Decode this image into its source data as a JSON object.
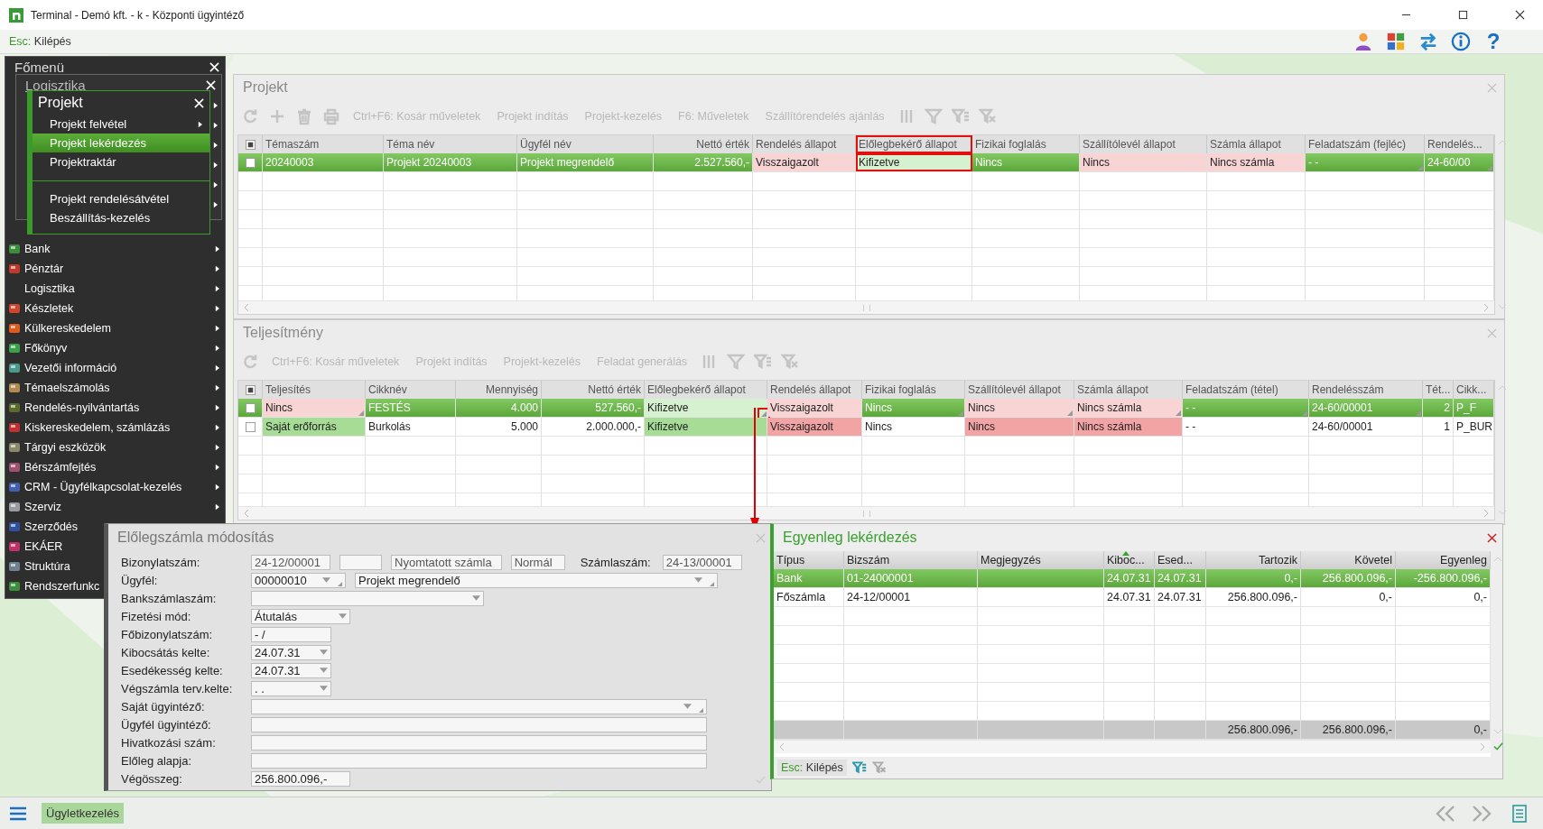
{
  "window": {
    "title": "Terminal - Demó kft. - k - Központi ügyintéző"
  },
  "top_bar": {
    "exit": {
      "key": "Esc:",
      "label": "Kilépés"
    },
    "help_glyph": "?"
  },
  "main_menu": {
    "title": "Főmenü",
    "items": [
      {
        "label": "Bank",
        "icon": true,
        "submenu": true
      },
      {
        "label": "Pénztár",
        "icon": true,
        "submenu": true
      },
      {
        "label": "Logisztika",
        "icon": false,
        "submenu": true
      },
      {
        "label": "Készletek",
        "icon": true,
        "submenu": true
      },
      {
        "label": "Külkereskedelem",
        "icon": true,
        "submenu": true
      },
      {
        "label": "Főkönyv",
        "icon": true,
        "submenu": true
      },
      {
        "label": "Vezetői információ",
        "icon": true,
        "submenu": true
      },
      {
        "label": "Témaelszámolás",
        "icon": true,
        "submenu": true
      },
      {
        "label": "Rendelés-nyilvántartás",
        "icon": true,
        "submenu": true
      },
      {
        "label": "Kiskereskedelem, számlázás",
        "icon": true,
        "submenu": true
      },
      {
        "label": "Tárgyi eszközök",
        "icon": true,
        "submenu": true
      },
      {
        "label": "Bérszámfejtés",
        "icon": true,
        "submenu": true
      },
      {
        "label": "CRM - Ügyfélkapcsolat-kezelés",
        "icon": true,
        "submenu": true
      },
      {
        "label": "Szerviz",
        "icon": true,
        "submenu": true
      },
      {
        "label": "Szerződés",
        "icon": true,
        "submenu": false
      },
      {
        "label": "EKÁER",
        "icon": true,
        "submenu": false
      },
      {
        "label": "Struktúra",
        "icon": true,
        "submenu": false
      },
      {
        "label": "Rendszerfunkc",
        "icon": true,
        "submenu": false
      }
    ]
  },
  "logistics_menu": {
    "title": "Logisztika"
  },
  "project_menu": {
    "title": "Projekt",
    "items": [
      {
        "kind": "item",
        "label": "Projekt felvétel",
        "selected": false,
        "submenu": true
      },
      {
        "kind": "item",
        "label": "Projekt lekérdezés",
        "selected": true,
        "submenu": false
      },
      {
        "kind": "item",
        "label": "Projektraktár",
        "selected": false,
        "submenu": false
      },
      {
        "kind": "separator"
      },
      {
        "kind": "item",
        "label": "Projekt rendelésátvétel",
        "selected": false,
        "submenu": false
      },
      {
        "kind": "item",
        "label": "Beszállítás-kezelés",
        "selected": false,
        "submenu": false
      }
    ]
  },
  "panels": [
    {
      "title": "Projekt",
      "select_all_partial": true,
      "toolbar": [
        {
          "kind": "refresh",
          "disabled": true
        },
        {
          "kind": "add",
          "disabled": true
        },
        {
          "kind": "delete",
          "disabled": true
        },
        {
          "kind": "print",
          "disabled": true
        },
        {
          "kind": "text",
          "label": "Ctrl+F6: Kosár műveletek",
          "disabled": true
        },
        {
          "kind": "text",
          "label": "Projekt indítás",
          "disabled": true
        },
        {
          "kind": "text",
          "label": "Projekt-kezelés",
          "disabled": true
        },
        {
          "kind": "text",
          "label": "F6: Műveletek",
          "disabled": true
        },
        {
          "kind": "text",
          "label": "Szállítórendelés ajánlás",
          "disabled": true
        },
        {
          "kind": "columns",
          "disabled": true
        },
        {
          "kind": "filter",
          "disabled": true
        },
        {
          "kind": "filter-add",
          "disabled": true
        },
        {
          "kind": "filter-clear",
          "disabled": true
        }
      ],
      "columns": [
        {
          "label": "Témaszám",
          "highlighted": false
        },
        {
          "label": "Téma név",
          "highlighted": false
        },
        {
          "label": "Ügyfél név",
          "highlighted": false
        },
        {
          "label": "Nettó érték",
          "highlighted": false
        },
        {
          "label": "Rendelés állapot",
          "highlighted": false
        },
        {
          "label": "Előlegbekérő állapot",
          "highlighted": true
        },
        {
          "label": "Fizikai foglalás",
          "highlighted": false
        },
        {
          "label": "Szállítólevél állapot",
          "highlighted": false
        },
        {
          "label": "Számla állapot",
          "highlighted": false
        },
        {
          "label": "Feladatszám (fejléc)",
          "highlighted": false
        },
        {
          "label": "Rendelés...",
          "highlighted": false
        }
      ],
      "rows": [
        {
          "selected": true,
          "checked": false,
          "cells": [
            {
              "text": "20240003"
            },
            {
              "text": "Projekt 20240003"
            },
            {
              "text": "Projekt megrendelő"
            },
            {
              "text": "2.527.560,-"
            },
            {
              "text": "Visszaigazolt",
              "alert": true
            },
            {
              "text": "Kifizetve",
              "ok": true,
              "highlighted": true
            },
            {
              "text": "Nincs"
            },
            {
              "text": "Nincs",
              "alert": true
            },
            {
              "text": "Nincs számla",
              "alert": true
            },
            {
              "text": "- -",
              "corner": true
            },
            {
              "text": "24-60/00",
              "corner": true
            }
          ]
        }
      ]
    },
    {
      "title": "Teljesítmény",
      "select_all_partial": true,
      "toolbar": [
        {
          "kind": "refresh",
          "disabled": true
        },
        {
          "kind": "text",
          "label": "Ctrl+F6: Kosár műveletek",
          "disabled": true
        },
        {
          "kind": "text",
          "label": "Projekt indítás",
          "disabled": true
        },
        {
          "kind": "text",
          "label": "Projekt-kezelés",
          "disabled": true
        },
        {
          "kind": "text",
          "label": "Feladat generálás",
          "disabled": true
        },
        {
          "kind": "columns",
          "disabled": true
        },
        {
          "kind": "filter",
          "disabled": true
        },
        {
          "kind": "filter-add",
          "disabled": true
        },
        {
          "kind": "filter-clear",
          "disabled": true
        }
      ],
      "columns": [
        {
          "label": "Teljesítés",
          "highlighted": false
        },
        {
          "label": "Cikknév",
          "highlighted": false
        },
        {
          "label": "Mennyiség",
          "highlighted": false
        },
        {
          "label": "Nettó érték",
          "highlighted": false
        },
        {
          "label": "Előlegbekérő állapot",
          "highlighted": false
        },
        {
          "label": "Rendelés állapot",
          "highlighted": false
        },
        {
          "label": "Fizikai foglalás",
          "highlighted": false
        },
        {
          "label": "Szállítólevél állapot",
          "highlighted": false
        },
        {
          "label": "Számla állapot",
          "highlighted": false
        },
        {
          "label": "Feladatszám (tétel)",
          "highlighted": false
        },
        {
          "label": "Rendelésszám",
          "highlighted": false
        },
        {
          "label": "Tét...",
          "highlighted": false
        },
        {
          "label": "Cikk...",
          "highlighted": false
        }
      ],
      "rows": [
        {
          "selected": true,
          "checked": false,
          "cells": [
            {
              "text": "Nincs",
              "alert": true,
              "corner": true
            },
            {
              "text": "FESTÉS"
            },
            {
              "text": "4.000"
            },
            {
              "text": "527.560,-"
            },
            {
              "text": "Kifizetve",
              "ok": true,
              "corner": true,
              "corner_highlighted": true
            },
            {
              "text": "Visszaigazolt",
              "alert": true
            },
            {
              "text": "Nincs",
              "corner": true
            },
            {
              "text": "Nincs",
              "alert": true,
              "corner": true
            },
            {
              "text": "Nincs számla",
              "alert": true,
              "corner": true
            },
            {
              "text": "- -",
              "corner": true
            },
            {
              "text": "24-60/00001",
              "corner": true
            },
            {
              "text": "2"
            },
            {
              "text": "P_F"
            }
          ]
        },
        {
          "selected": false,
          "checked": false,
          "cells": [
            {
              "text": "Saját erőforrás",
              "ok": true
            },
            {
              "text": "Burkolás"
            },
            {
              "text": "5.000"
            },
            {
              "text": "2.000.000,-"
            },
            {
              "text": "Kifizetve",
              "ok": true
            },
            {
              "text": "Visszaigazolt",
              "alert": true
            },
            {
              "text": "Nincs"
            },
            {
              "text": "Nincs",
              "alert": true
            },
            {
              "text": "Nincs számla",
              "alert": true
            },
            {
              "text": "- -"
            },
            {
              "text": "24-60/00001"
            },
            {
              "text": "1"
            },
            {
              "text": "P_BUR"
            }
          ]
        }
      ]
    }
  ],
  "callout_arrow": true,
  "advance_invoice_dialog": {
    "title": "Előlegszámla módosítás",
    "rows": [
      {
        "label": "Bizonylatszám:",
        "fields": [
          {
            "kind": "readonly",
            "value": "24-12/00001"
          },
          {
            "kind": "readonly-blank"
          },
          {
            "kind": "readonly",
            "value": "Nyomtatott számla"
          },
          {
            "kind": "readonly",
            "value": "Normál"
          },
          {
            "kind": "label",
            "value": "Számlaszám:"
          },
          {
            "kind": "readonly",
            "value": "24-13/00001"
          }
        ]
      },
      {
        "label": "Ügyfél:",
        "fields": [
          {
            "kind": "code-combo",
            "value": "00000010"
          },
          {
            "kind": "wide-combo",
            "value": "Projekt megrendelő"
          }
        ]
      },
      {
        "label": "Bankszámlaszám:",
        "fields": [
          {
            "kind": "account-select"
          }
        ]
      },
      {
        "label": "Fizetési mód:",
        "fields": [
          {
            "kind": "select",
            "value": "Átutalás"
          }
        ]
      },
      {
        "label": "Főbizonylatszám:",
        "fields": [
          {
            "kind": "input",
            "value": "-  /"
          }
        ]
      },
      {
        "label": "Kibocsátás kelte:",
        "fields": [
          {
            "kind": "date",
            "value": "24.07.31"
          }
        ]
      },
      {
        "label": "Esedékesség kelte:",
        "fields": [
          {
            "kind": "date",
            "value": "24.07.31"
          }
        ]
      },
      {
        "label": "Végszámla terv.kelte:",
        "fields": [
          {
            "kind": "date",
            "value": ".  ."
          }
        ]
      },
      {
        "label": "Saját ügyintéző:",
        "fields": [
          {
            "kind": "wide-combo"
          }
        ]
      },
      {
        "label": "Ügyfél ügyintéző:",
        "fields": [
          {
            "kind": "wide-input"
          }
        ]
      },
      {
        "label": "Hivatkozási szám:",
        "fields": [
          {
            "kind": "wide-input"
          }
        ]
      },
      {
        "label": "Előleg alapja:",
        "fields": [
          {
            "kind": "wide-input"
          }
        ]
      },
      {
        "label": "Végösszeg:",
        "fields": [
          {
            "kind": "amount",
            "value": "256.800.096,-"
          }
        ]
      }
    ]
  },
  "balance_dialog": {
    "title": "Egyenleg lekérdezés",
    "columns": [
      {
        "label": "Típus",
        "sorted": false
      },
      {
        "label": "Bizszám",
        "sorted": false
      },
      {
        "label": "Megjegyzés",
        "sorted": false
      },
      {
        "label": "Kiboc...",
        "sorted": true
      },
      {
        "label": "Esed...",
        "sorted": false
      },
      {
        "label": "Tartozik",
        "sorted": false
      },
      {
        "label": "Követel",
        "sorted": false
      },
      {
        "label": "Egyenleg",
        "sorted": false
      }
    ],
    "rows": [
      {
        "selected": true,
        "type": "Bank",
        "doc_no": "01-24000001",
        "issued": "24.07.31",
        "due": "24.07.31",
        "debit": "0,-",
        "credit": "256.800.096,-",
        "balance": "-256.800.096,-"
      },
      {
        "selected": false,
        "type": "Főszámla",
        "doc_no": "24-12/00001",
        "issued": "24.07.31",
        "due": "24.07.31",
        "debit": "256.800.096,-",
        "credit": "0,-",
        "balance": "0,-"
      }
    ],
    "totals": {
      "debit": "256.800.096,-",
      "credit": "256.800.096,-",
      "balance": "0,-"
    },
    "exit": {
      "key": "Esc:",
      "label": "Kilépés"
    }
  },
  "bottom_bar": {
    "tab": {
      "label": "Ügyletkezelés",
      "selected": true
    }
  }
}
